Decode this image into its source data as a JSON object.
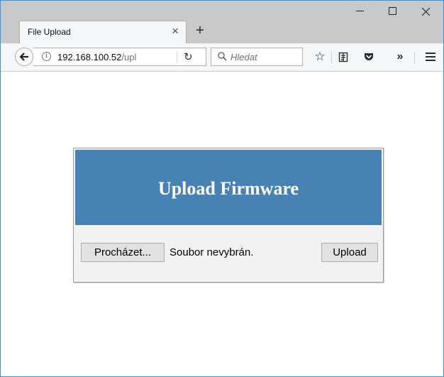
{
  "browser": {
    "tab_title": "File Upload",
    "new_tab_label": "+",
    "url_host": "192.168.100.52",
    "url_path": "/upl",
    "search_placeholder": "Hledat"
  },
  "icons": {
    "info": "info-icon",
    "reload": "reload-icon",
    "search": "search-icon",
    "bookmark": "star-icon",
    "reader": "reader-view-icon",
    "pocket": "pocket-icon",
    "overflow": "overflow-chevron-icon",
    "menu": "hamburger-menu-icon"
  },
  "page": {
    "title": "Upload Firmware",
    "browse_label": "Procházet...",
    "file_status": "Soubor nevybrán.",
    "upload_label": "Upload"
  },
  "colors": {
    "header_bg": "#4682b4",
    "window_border": "#2b97e6"
  }
}
